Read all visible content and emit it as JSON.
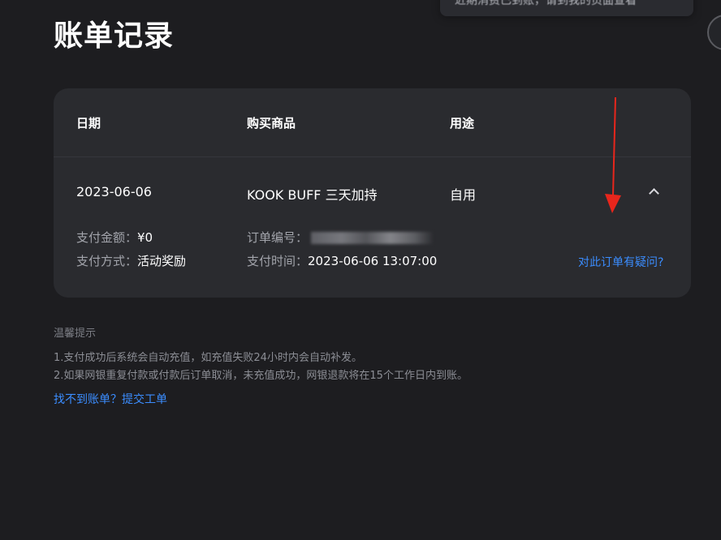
{
  "header": {
    "title": "账单记录"
  },
  "toast": {
    "text": "近期消费已到账，请到我的页面查看"
  },
  "table": {
    "columns": [
      "日期",
      "购买商品",
      "用途"
    ],
    "row": {
      "date": "2023-06-06",
      "product": "KOOK BUFF 三天加持",
      "usage": "自用"
    },
    "details": {
      "amount_label": "支付金额：",
      "amount_value": "¥0",
      "method_label": "支付方式：",
      "method_value": "活动奖励",
      "order_no_label": "订单编号：",
      "pay_time_label": "支付时间：",
      "pay_time_value": "2023-06-06 13:07:00"
    },
    "question_link": "对此订单有疑问?"
  },
  "tips": {
    "title": "温馨提示",
    "items": [
      "1.支付成功后系统会自动充值，如充值失败24小时内会自动补发。",
      "2.如果网银重复付款或付款后订单取消，未充值成功，网银退款将在15个工作日内到账。"
    ],
    "link": "找不到账单？提交工单"
  },
  "colors": {
    "background": "#1d1d20",
    "card": "#2a2b2f",
    "link": "#3b8dff",
    "annotation_arrow": "#e8261c"
  },
  "icons": {
    "expand_toggle": "chevron-up-icon"
  }
}
